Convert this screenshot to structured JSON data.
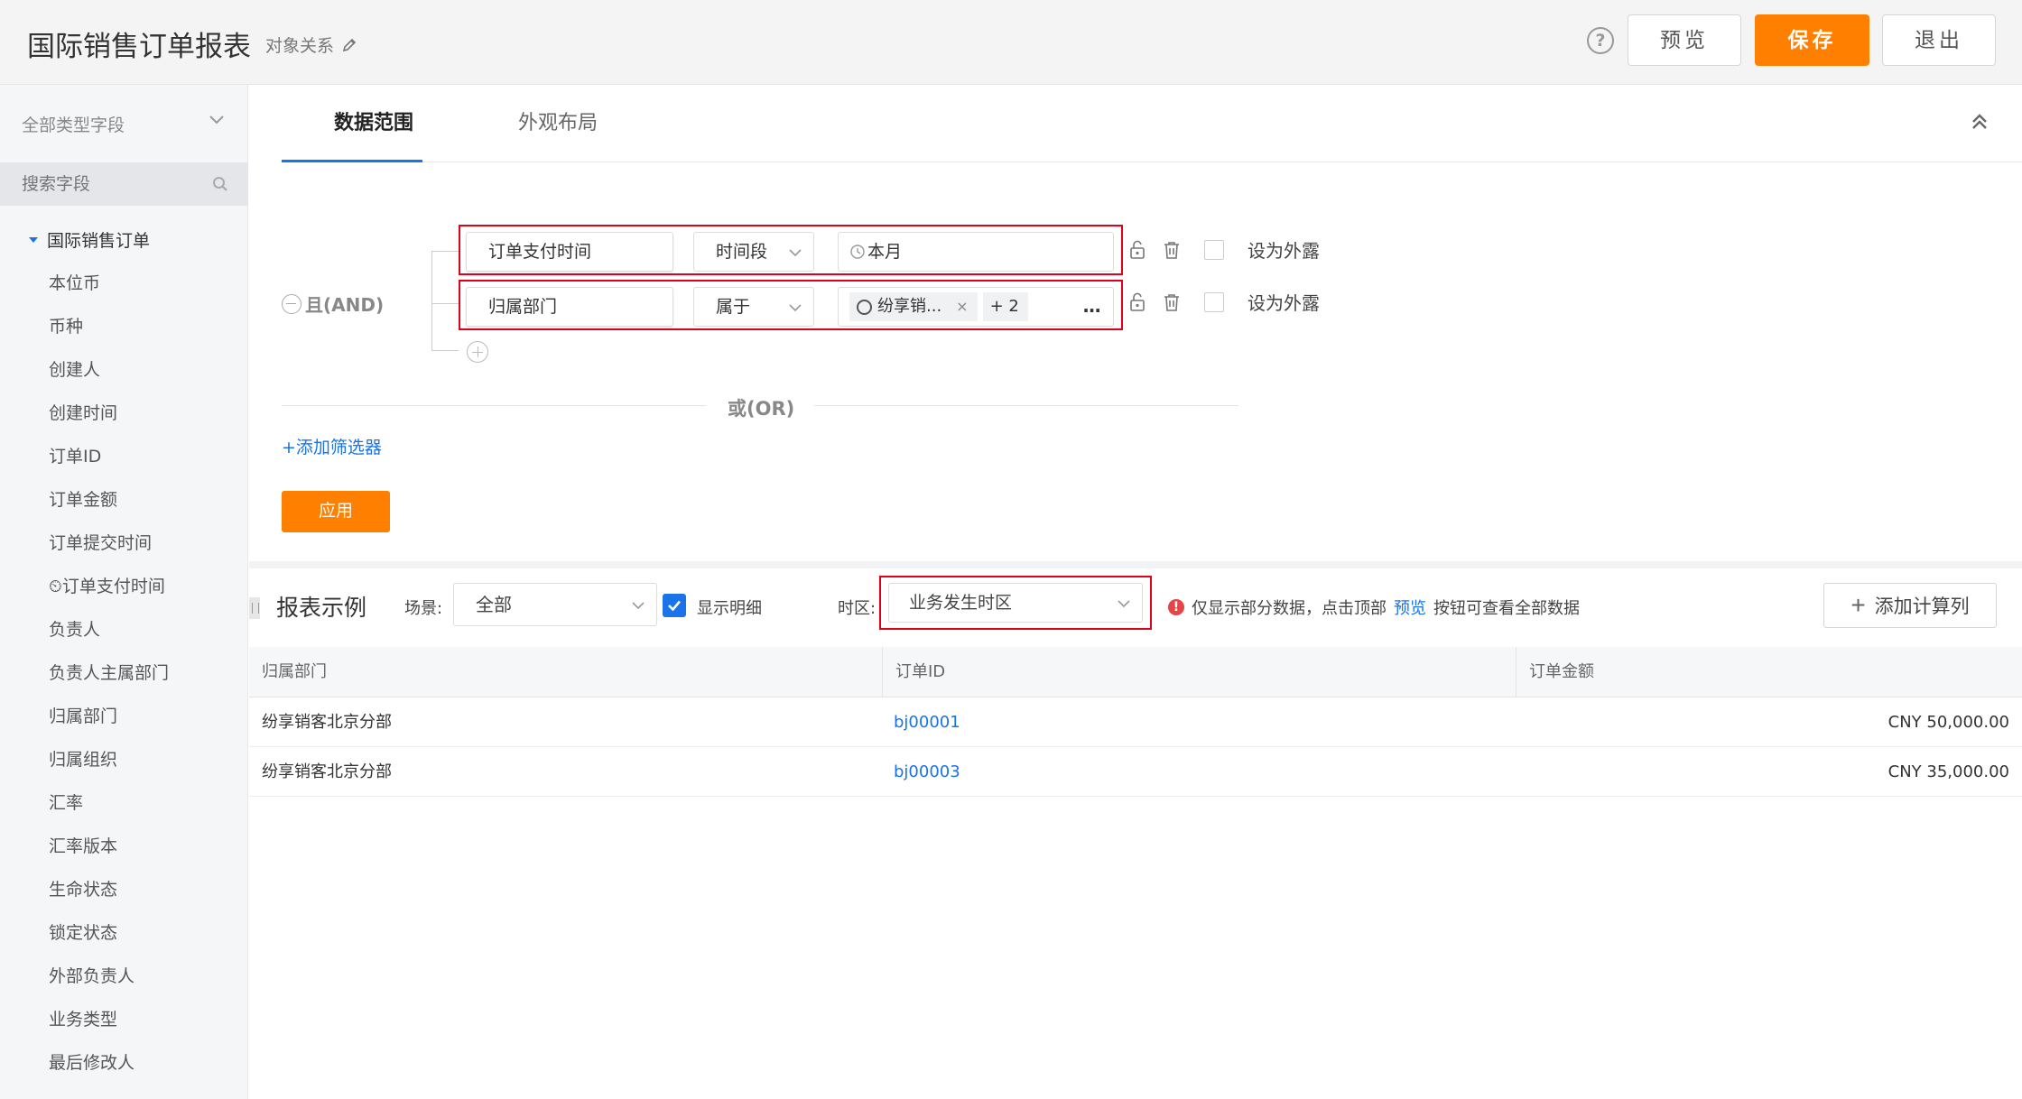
{
  "header": {
    "title": "国际销售订单报表",
    "object_relation": "对象关系",
    "help": "?",
    "preview": "预览",
    "save": "保存",
    "exit": "退出"
  },
  "sidebar": {
    "type_filter": "全部类型字段",
    "search_placeholder": "搜索字段",
    "root": "国际销售订单",
    "items": [
      "本位币",
      "币种",
      "创建人",
      "创建时间",
      "订单ID",
      "订单金额",
      "订单提交时间",
      "⏲订单支付时间",
      "负责人",
      "负责人主属部门",
      "归属部门",
      "归属组织",
      "汇率",
      "汇率版本",
      "生命状态",
      "锁定状态",
      "外部负责人",
      "业务类型",
      "最后修改人"
    ]
  },
  "tabs": {
    "data_range": "数据范围",
    "layout": "外观布局"
  },
  "filter": {
    "and_label": "且(AND)",
    "or_label": "或(OR)",
    "add_filter": "+添加筛选器",
    "apply": "应用",
    "expose_label": "设为外露",
    "conditions": [
      {
        "field": "订单支付时间",
        "operator": "时间段",
        "value": "本月"
      },
      {
        "field": "归属部门",
        "operator": "属于",
        "tag": "纷享销...",
        "extra": "+ 2",
        "more": "···"
      }
    ]
  },
  "report": {
    "title": "报表示例",
    "scene_label": "场景:",
    "scene_value": "全部",
    "show_detail": "显示明细",
    "tz_label": "时区:",
    "tz_value": "业务发生时区",
    "warn_before": "仅显示部分数据，点击顶部",
    "warn_link": "预览",
    "warn_after": "按钮可查看全部数据",
    "add_calc": "添加计算列"
  },
  "table": {
    "columns": [
      "归属部门",
      "订单ID",
      "订单金额"
    ],
    "rows": [
      [
        "纷享销客北京分部",
        "bj00001",
        "CNY 50,000.00"
      ],
      [
        "纷享销客北京分部",
        "bj00003",
        "CNY 35,000.00"
      ]
    ]
  },
  "colors": {
    "accent": "#ff7f00",
    "link": "#1a73e8",
    "highlight": "#e0001a"
  }
}
